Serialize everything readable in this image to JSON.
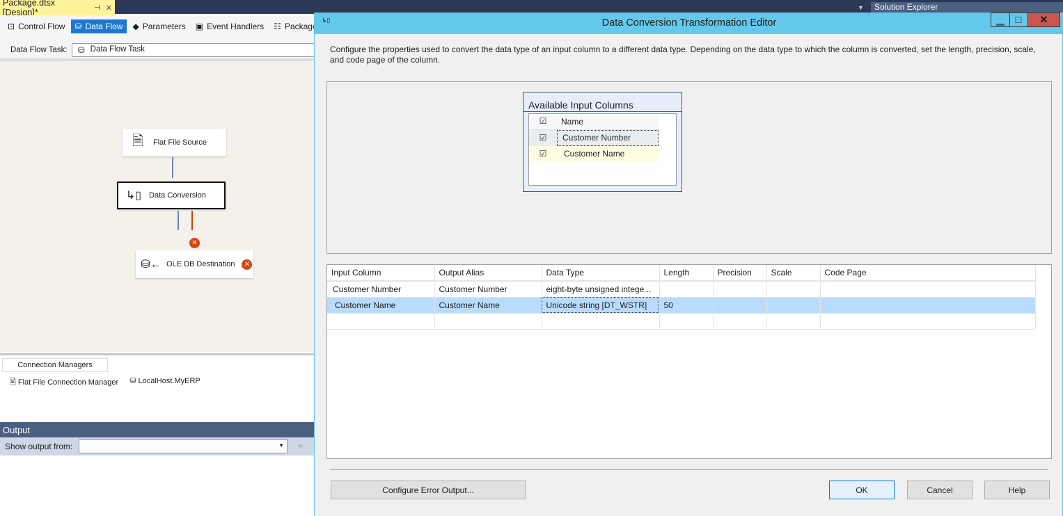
{
  "ide": {
    "doc_tab": "Package.dtsx [Design]*",
    "pin": "⊣",
    "close": "✕",
    "solution_explorer": "Solution Explorer",
    "tabs": [
      {
        "label": "Control Flow",
        "icon": "control-flow-icon"
      },
      {
        "label": "Data Flow",
        "icon": "data-flow-icon",
        "active": true
      },
      {
        "label": "Parameters",
        "icon": "parameters-icon"
      },
      {
        "label": "Event Handlers",
        "icon": "event-handlers-icon"
      },
      {
        "label": "Package Explorer",
        "icon": "package-explorer-icon"
      }
    ],
    "task_label": "Data Flow Task:",
    "task_value": "Data Flow Task",
    "nodes": {
      "source": "Flat File Source",
      "conversion": "Data Conversion",
      "destination": "OLE DB Destination"
    },
    "connection_managers_tab": "Connection Managers",
    "connections": [
      "Flat File Connection Manager",
      "LocalHost.MyERP"
    ],
    "output_title": "Output",
    "show_output_label": "Show output from:",
    "show_output_value": ""
  },
  "dialog": {
    "title": "Data Conversion Transformation Editor",
    "title_color": "#64c8ea",
    "description": "Configure the properties used to convert the data type of an input column to a different data type. Depending on the data type to which the column is converted, set the length, precision, scale, and code page of the column.",
    "available": {
      "title": "Available Input Columns",
      "header": "Name",
      "columns": [
        {
          "name": "Customer Number",
          "checked": true
        },
        {
          "name": "Customer Name",
          "checked": true
        }
      ]
    },
    "grid": {
      "headers": [
        "Input Column",
        "Output Alias",
        "Data Type",
        "Length",
        "Precision",
        "Scale",
        "Code Page"
      ],
      "rows": [
        [
          "Customer Number",
          "Customer Number",
          "eight-byte unsigned intege...",
          "",
          "",
          "",
          ""
        ],
        [
          "Customer Name",
          "Customer Name",
          "Unicode string [DT_WSTR]",
          "50",
          "",
          "",
          ""
        ]
      ],
      "selected_row": 1
    },
    "buttons": {
      "error": "Configure Error Output...",
      "ok": "OK",
      "cancel": "Cancel",
      "help": "Help"
    }
  }
}
